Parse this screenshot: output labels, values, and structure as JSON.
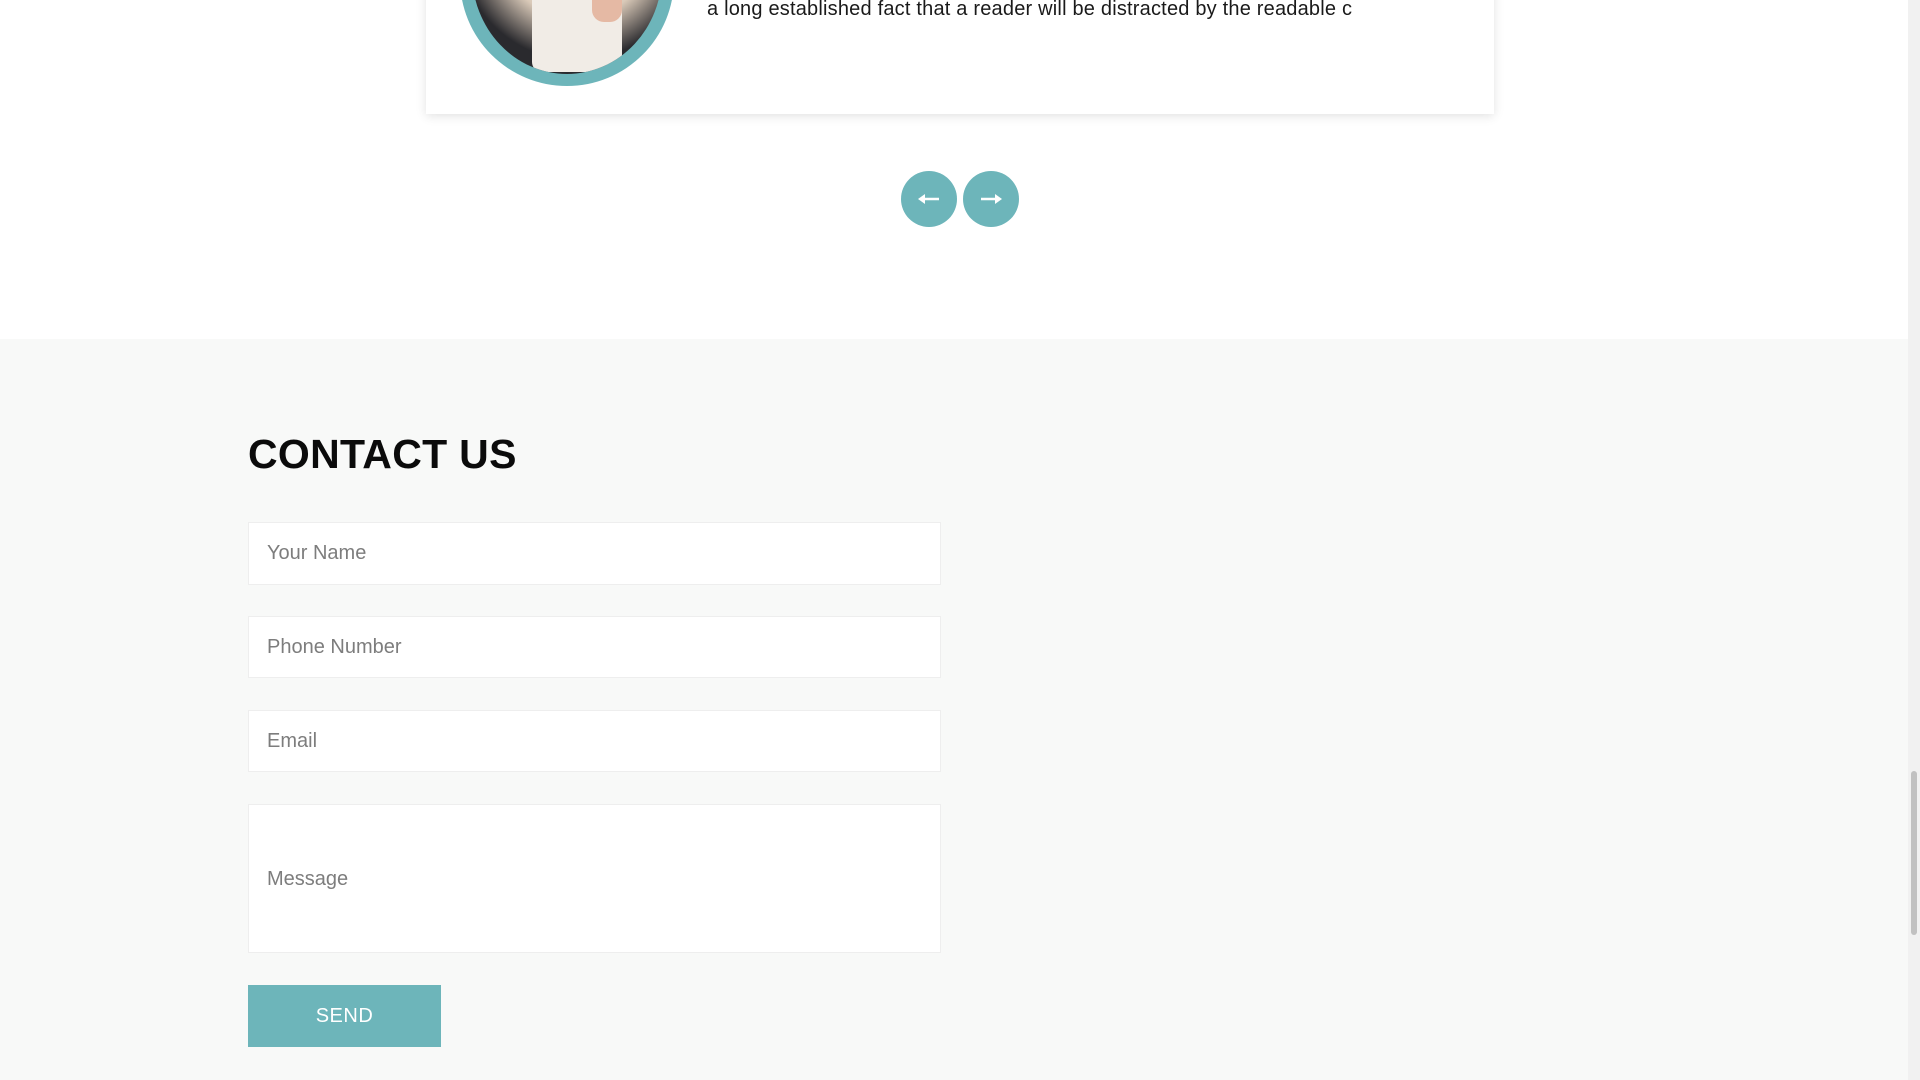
{
  "testimonial": {
    "text": "a long established fact that a reader will be distracted by the readable c"
  },
  "carousel": {
    "prev_icon": "arrow-left-icon",
    "next_icon": "arrow-right-icon"
  },
  "contact": {
    "title": "CONTACT US",
    "fields": {
      "name_placeholder": "Your Name",
      "phone_placeholder": "Phone Number",
      "email_placeholder": "Email",
      "message_placeholder": "Message"
    },
    "send_label": "SEND"
  },
  "colors": {
    "accent": "#6db5ba",
    "section_bg": "#f8f9f8"
  }
}
